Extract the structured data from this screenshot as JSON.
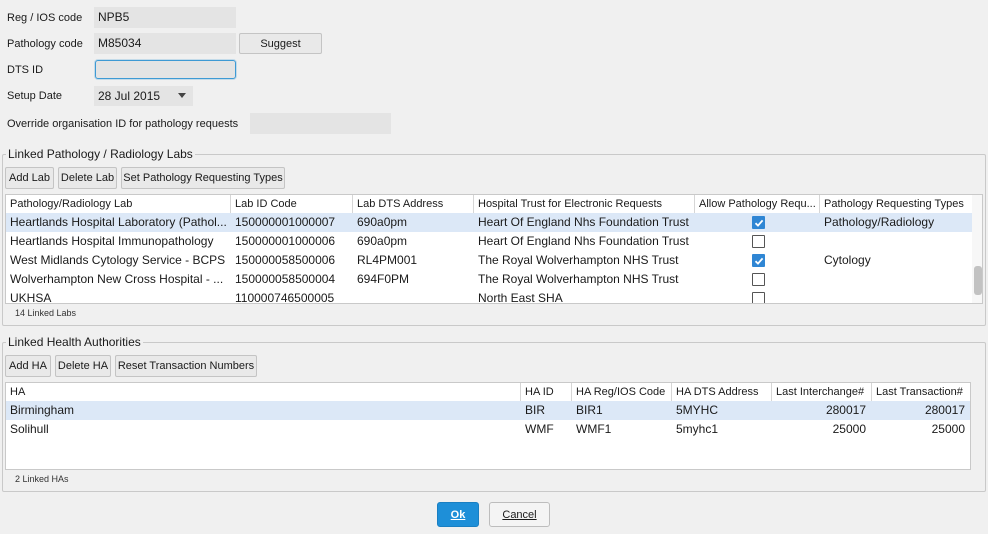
{
  "form": {
    "reg_label": "Reg / IOS code",
    "reg_value": "NPB5",
    "pathology_code_label": "Pathology code",
    "pathology_code_value": "M85034",
    "suggest_button": "Suggest",
    "dts_label": "DTS ID",
    "dts_value": "",
    "setup_date_label": "Setup Date",
    "setup_date_value": "28 Jul 2015",
    "override_label": "Override organisation ID for pathology requests",
    "override_value": ""
  },
  "labs": {
    "title": "Linked Pathology / Radiology Labs",
    "buttons": {
      "add": "Add Lab",
      "delete": "Delete Lab",
      "set_types": "Set Pathology Requesting Types"
    },
    "columns": [
      "Pathology/Radiology Lab",
      "Lab ID Code",
      "Lab DTS Address",
      "Hospital Trust for Electronic Requests",
      "Allow Pathology Requ...",
      "Pathology Requesting Types"
    ],
    "rows": [
      {
        "lab": "Heartlands Hospital Laboratory (Pathol...",
        "id": "150000001000007",
        "dts": "690a0pm",
        "trust": "Heart Of England Nhs Foundation Trust",
        "allow": true,
        "types": "Pathology/Radiology",
        "selected": true
      },
      {
        "lab": "Heartlands Hospital Immunopathology",
        "id": "150000001000006",
        "dts": "690a0pm",
        "trust": "Heart Of England Nhs Foundation Trust",
        "allow": false,
        "types": "",
        "selected": false
      },
      {
        "lab": "West Midlands Cytology Service - BCPS",
        "id": "150000058500006",
        "dts": "RL4PM001",
        "trust": "The Royal Wolverhampton NHS Trust",
        "allow": true,
        "types": "Cytology",
        "selected": false
      },
      {
        "lab": "Wolverhampton New Cross Hospital - ...",
        "id": "150000058500004",
        "dts": "694F0PM",
        "trust": "The Royal Wolverhampton NHS Trust",
        "allow": false,
        "types": "",
        "selected": false
      },
      {
        "lab": "UKHSA",
        "id": "110000746500005",
        "dts": "",
        "trust": "North East SHA",
        "allow": false,
        "types": "",
        "selected": false
      }
    ],
    "count_label": "14 Linked Labs"
  },
  "has": {
    "title": "Linked Health Authorities",
    "buttons": {
      "add": "Add HA",
      "delete": "Delete HA",
      "reset": "Reset Transaction Numbers"
    },
    "columns": [
      "HA",
      "HA ID",
      "HA Reg/IOS Code",
      "HA DTS Address",
      "Last Interchange#",
      "Last Transaction#"
    ],
    "rows": [
      {
        "ha": "Birmingham",
        "id": "BIR",
        "reg": "BIR1",
        "dts": "5MYHC",
        "interchange": "280017",
        "transaction": "280017",
        "selected": true
      },
      {
        "ha": "Solihull",
        "id": "WMF",
        "reg": "WMF1",
        "dts": "5myhc1",
        "interchange": "25000",
        "transaction": "25000",
        "selected": false
      }
    ],
    "count_label": "2 Linked HAs"
  },
  "footer": {
    "ok": "Ok",
    "cancel": "Cancel"
  },
  "colors": {
    "accent": "#1e8fd8",
    "selected_row": "#dce8f7",
    "checkbox_checked": "#2f86d4"
  }
}
